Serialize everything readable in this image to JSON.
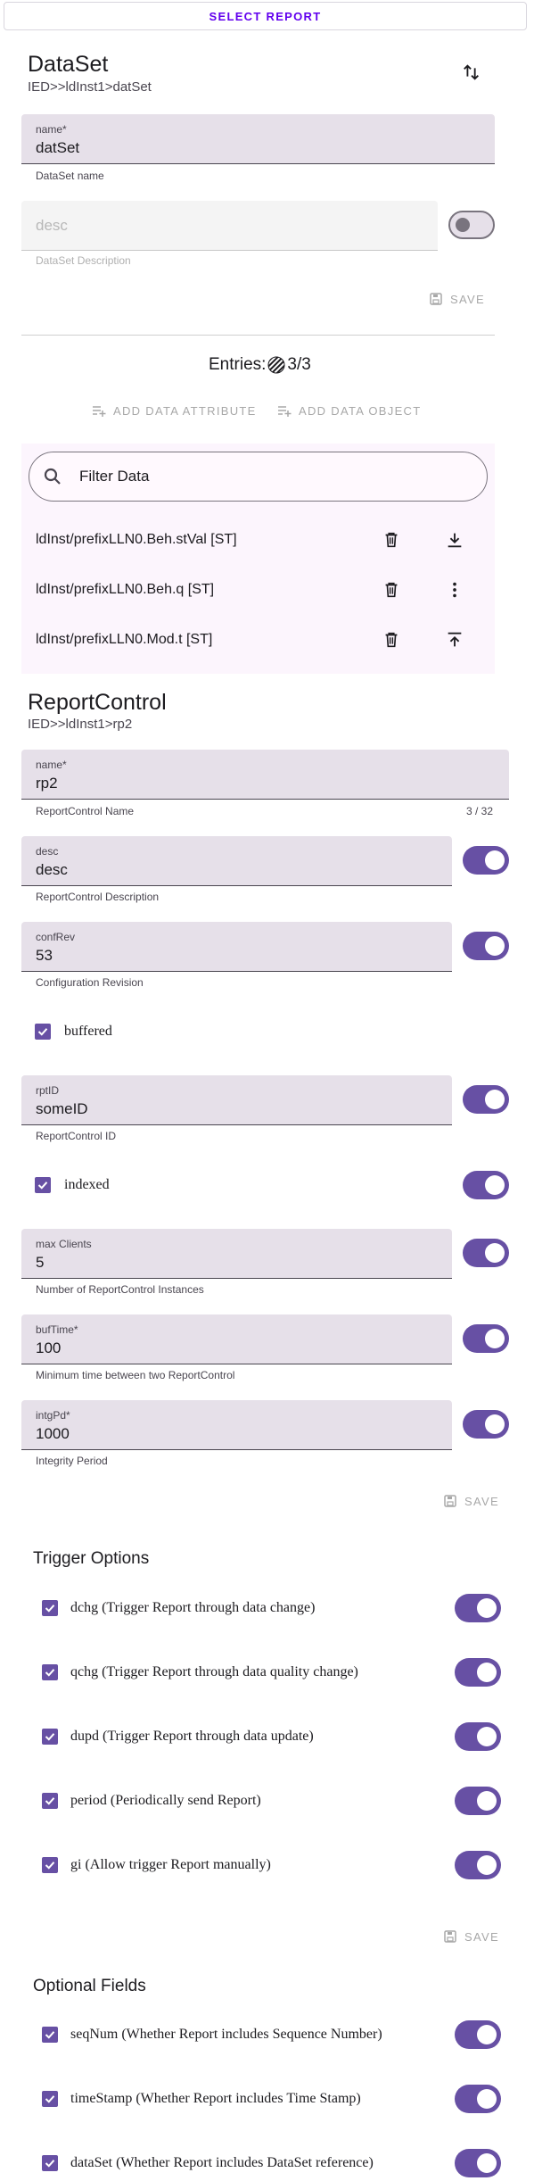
{
  "top": {
    "select_report_label": "SELECT REPORT"
  },
  "dataset": {
    "title": "DataSet",
    "path": "IED>>ldInst1>datSet",
    "name_label": "name*",
    "name_value": "datSet",
    "name_helper": "DataSet name",
    "desc_placeholder": "desc",
    "desc_helper": "DataSet Description",
    "save_label": "SAVE",
    "entries_label": "Entries:",
    "entries_count": "3/3",
    "add_attribute_label": "ADD DATA ATTRIBUTE",
    "add_object_label": "ADD DATA OBJECT",
    "filter_placeholder": "Filter Data",
    "items": [
      {
        "text": "ldInst/prefixLLN0.Beh.stVal [ST]",
        "action_icon": "move-down-icon"
      },
      {
        "text": "ldInst/prefixLLN0.Beh.q [ST]",
        "action_icon": "more-vert-icon"
      },
      {
        "text": "ldInst/prefixLLN0.Mod.t [ST]",
        "action_icon": "move-up-icon"
      }
    ]
  },
  "report": {
    "title": "ReportControl",
    "path": "IED>>ldInst1>rp2",
    "name": {
      "label": "name*",
      "value": "rp2",
      "helper": "ReportControl Name",
      "counter": "3 / 32"
    },
    "desc": {
      "label": "desc",
      "value": "desc",
      "helper": "ReportControl Description"
    },
    "confRev": {
      "label": "confRev",
      "value": "53",
      "helper": "Configuration Revision"
    },
    "buffered_label": "buffered",
    "rptID": {
      "label": "rptID",
      "value": "someID",
      "helper": "ReportControl ID"
    },
    "indexed_label": "indexed",
    "maxClients": {
      "label": "max Clients",
      "value": "5",
      "helper": "Number of ReportControl Instances"
    },
    "bufTime": {
      "label": "bufTime*",
      "value": "100",
      "helper": "Minimum time between two ReportControl"
    },
    "intgPd": {
      "label": "intgPd*",
      "value": "1000",
      "helper": "Integrity Period"
    },
    "save_label": "SAVE"
  },
  "trigger": {
    "title": "Trigger Options",
    "items": [
      "dchg (Trigger Report through data change)",
      "qchg (Trigger Report through data quality change)",
      "dupd (Trigger Report through data update)",
      "period (Periodically send Report)",
      "gi (Allow trigger Report manually)"
    ],
    "save_label": "SAVE"
  },
  "optional": {
    "title": "Optional Fields",
    "items": [
      "seqNum (Whether Report includes Sequence Number)",
      "timeStamp (Whether Report includes Time Stamp)",
      "dataSet (Whether Report includes DataSet reference)"
    ]
  },
  "colors": {
    "primary": "#6750a4",
    "accent_text": "#6200ee",
    "field_bg": "#e6e0e9"
  }
}
